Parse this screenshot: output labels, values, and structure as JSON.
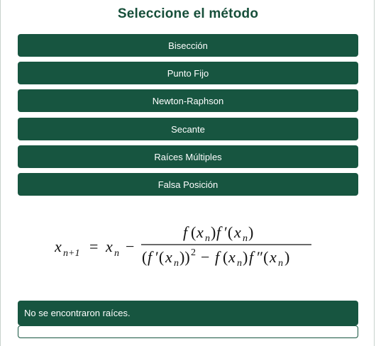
{
  "page": {
    "title": "Seleccione el método"
  },
  "methods": [
    {
      "label": "Bisección"
    },
    {
      "label": "Punto Fijo"
    },
    {
      "label": "Newton-Raphson"
    },
    {
      "label": "Secante"
    },
    {
      "label": "Raíces Múltiples"
    },
    {
      "label": "Falsa Posición"
    }
  ],
  "formula": {
    "lhs_var": "x",
    "lhs_sub": "n+1",
    "equals": "=",
    "rhs_var": "x",
    "rhs_sub": "n",
    "minus": "−",
    "numerator": "f(xn)f′(xn)",
    "denominator": "(f′(xn))² − f(xn)f″(xn)"
  },
  "result": {
    "message": "No se encontraron raíces."
  },
  "colors": {
    "accent": "#175540",
    "title": "#174f3a"
  }
}
